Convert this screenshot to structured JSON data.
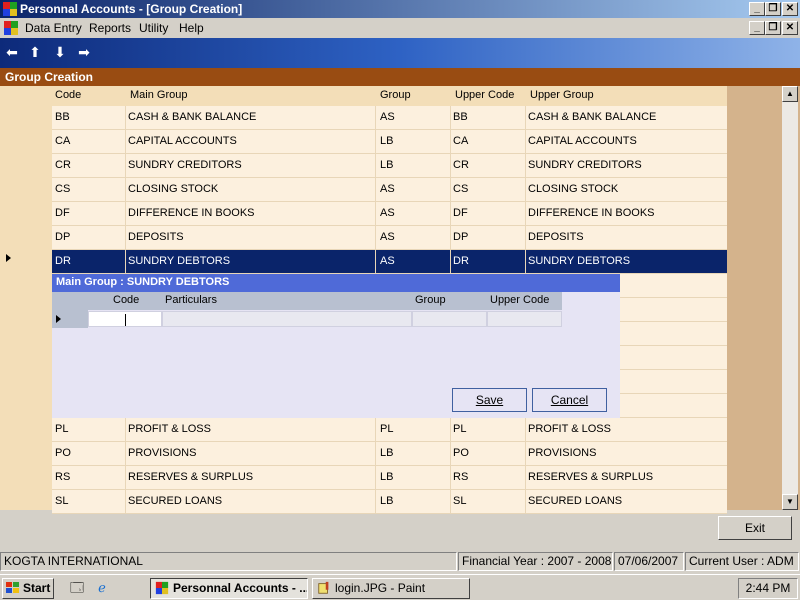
{
  "window": {
    "title": "Personnal Accounts - [Group Creation]"
  },
  "menu": {
    "items": [
      {
        "label": "Data Entry"
      },
      {
        "label": "Reports"
      },
      {
        "label": "Utility"
      },
      {
        "label": "Help"
      }
    ]
  },
  "form": {
    "title": "Group Creation"
  },
  "grid": {
    "headers": [
      "Code",
      "Main Group",
      "Group",
      "Upper Code",
      "Upper Group"
    ],
    "rows": [
      {
        "code": "BB",
        "main_group": "CASH & BANK BALANCE",
        "group": "AS",
        "upper_code": "BB",
        "upper_group": "CASH & BANK BALANCE"
      },
      {
        "code": "CA",
        "main_group": "CAPITAL ACCOUNTS",
        "group": "LB",
        "upper_code": "CA",
        "upper_group": "CAPITAL ACCOUNTS"
      },
      {
        "code": "CR",
        "main_group": "SUNDRY CREDITORS",
        "group": "LB",
        "upper_code": "CR",
        "upper_group": "SUNDRY CREDITORS"
      },
      {
        "code": "CS",
        "main_group": "CLOSING STOCK",
        "group": "AS",
        "upper_code": "CS",
        "upper_group": "CLOSING STOCK"
      },
      {
        "code": "DF",
        "main_group": "DIFFERENCE IN BOOKS",
        "group": "AS",
        "upper_code": "DF",
        "upper_group": "DIFFERENCE IN BOOKS"
      },
      {
        "code": "DP",
        "main_group": "DEPOSITS",
        "group": "AS",
        "upper_code": "DP",
        "upper_group": "DEPOSITS"
      },
      {
        "code": "DR",
        "main_group": "SUNDRY DEBTORS",
        "group": "AS",
        "upper_code": "DR",
        "upper_group": "SUNDRY DEBTORS"
      },
      {
        "code": "",
        "main_group": "",
        "group": "",
        "upper_code": "",
        "upper_group": ""
      },
      {
        "code": "",
        "main_group": "",
        "group": "",
        "upper_code": "",
        "upper_group": ""
      },
      {
        "code": "",
        "main_group": "",
        "group": "",
        "upper_code": "",
        "upper_group": "NCES"
      },
      {
        "code": "",
        "main_group": "",
        "group": "",
        "upper_code": "",
        "upper_group": "A/C."
      },
      {
        "code": "",
        "main_group": "",
        "group": "",
        "upper_code": "",
        "upper_group": ""
      },
      {
        "code": "",
        "main_group": "",
        "group": "",
        "upper_code": "",
        "upper_group": ""
      },
      {
        "code": "PL",
        "main_group": "PROFIT & LOSS",
        "group": "PL",
        "upper_code": "PL",
        "upper_group": "PROFIT & LOSS"
      },
      {
        "code": "PO",
        "main_group": "PROVISIONS",
        "group": "LB",
        "upper_code": "PO",
        "upper_group": "PROVISIONS"
      },
      {
        "code": "RS",
        "main_group": "RESERVES & SURPLUS",
        "group": "LB",
        "upper_code": "RS",
        "upper_group": "RESERVES & SURPLUS"
      },
      {
        "code": "SL",
        "main_group": "SECURED LOANS",
        "group": "LB",
        "upper_code": "SL",
        "upper_group": "SECURED LOANS"
      }
    ],
    "selected_index": 6
  },
  "subform": {
    "title": "Main Group : SUNDRY DEBTORS",
    "headers": [
      "Code",
      "Particulars",
      "Group",
      "Upper Code"
    ],
    "save_label": "Save",
    "cancel_label": "Cancel"
  },
  "exit_label": "Exit",
  "status": {
    "company": "KOGTA INTERNATIONAL",
    "financial_year": "Financial Year : 2007 - 2008",
    "date": "07/06/2007",
    "user": "Current User : ADM"
  },
  "taskbar": {
    "start_label": "Start",
    "tasks": [
      {
        "label": "Personnal Accounts - ...",
        "active": true
      },
      {
        "label": "login.JPG - Paint",
        "active": false
      }
    ],
    "clock": "2:44 PM"
  },
  "colors": {
    "form_header": "#994c12",
    "selected_row": "#0a246a",
    "subform_title": "#4f6ad8",
    "row_bg": "#fcf0de"
  }
}
